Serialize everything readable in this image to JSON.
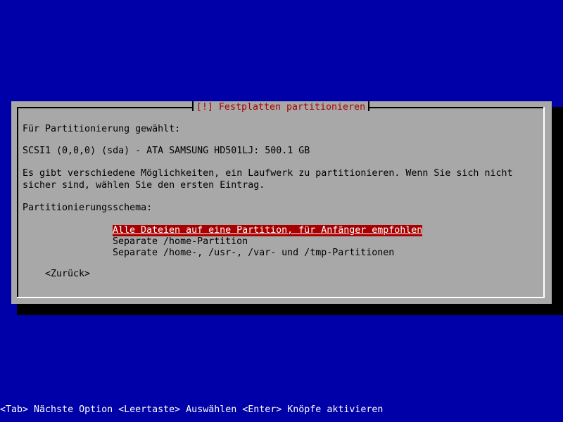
{
  "dialog": {
    "title": "[!] Festplatten partitionieren",
    "intro_label": "Für Partitionierung gewählt:",
    "disk": "SCSI1 (0,0,0) (sda) - ATA SAMSUNG HD501LJ: 500.1 GB",
    "description_line1": "Es gibt verschiedene Möglichkeiten, ein Laufwerk zu partitionieren. Wenn Sie sich nicht",
    "description_line2": "sicher sind, wählen Sie den ersten Eintrag.",
    "scheme_label": "Partitionierungsschema:",
    "options": [
      "Alle Dateien auf eine Partition, für Anfänger empfohlen",
      "Separate /home-Partition",
      "Separate /home-, /usr-, /var- und /tmp-Partitionen"
    ],
    "back_label": "<Zurück>"
  },
  "statusbar": {
    "text": "<Tab> Nächste Option <Leertaste> Auswählen <Enter> Knöpfe aktivieren"
  },
  "colors": {
    "background": "#0000a8",
    "dialog": "#a8a8a8",
    "title": "#a80000",
    "selection": "#a80000"
  }
}
